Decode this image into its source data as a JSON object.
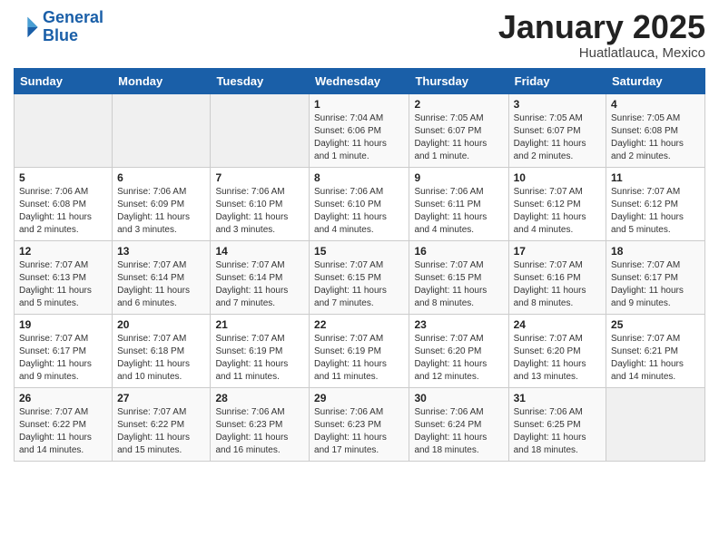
{
  "header": {
    "logo_line1": "General",
    "logo_line2": "Blue",
    "month": "January 2025",
    "location": "Huatlatlauca, Mexico"
  },
  "weekdays": [
    "Sunday",
    "Monday",
    "Tuesday",
    "Wednesday",
    "Thursday",
    "Friday",
    "Saturday"
  ],
  "weeks": [
    [
      {
        "day": "",
        "info": ""
      },
      {
        "day": "",
        "info": ""
      },
      {
        "day": "",
        "info": ""
      },
      {
        "day": "1",
        "info": "Sunrise: 7:04 AM\nSunset: 6:06 PM\nDaylight: 11 hours\nand 1 minute."
      },
      {
        "day": "2",
        "info": "Sunrise: 7:05 AM\nSunset: 6:07 PM\nDaylight: 11 hours\nand 1 minute."
      },
      {
        "day": "3",
        "info": "Sunrise: 7:05 AM\nSunset: 6:07 PM\nDaylight: 11 hours\nand 2 minutes."
      },
      {
        "day": "4",
        "info": "Sunrise: 7:05 AM\nSunset: 6:08 PM\nDaylight: 11 hours\nand 2 minutes."
      }
    ],
    [
      {
        "day": "5",
        "info": "Sunrise: 7:06 AM\nSunset: 6:08 PM\nDaylight: 11 hours\nand 2 minutes."
      },
      {
        "day": "6",
        "info": "Sunrise: 7:06 AM\nSunset: 6:09 PM\nDaylight: 11 hours\nand 3 minutes."
      },
      {
        "day": "7",
        "info": "Sunrise: 7:06 AM\nSunset: 6:10 PM\nDaylight: 11 hours\nand 3 minutes."
      },
      {
        "day": "8",
        "info": "Sunrise: 7:06 AM\nSunset: 6:10 PM\nDaylight: 11 hours\nand 4 minutes."
      },
      {
        "day": "9",
        "info": "Sunrise: 7:06 AM\nSunset: 6:11 PM\nDaylight: 11 hours\nand 4 minutes."
      },
      {
        "day": "10",
        "info": "Sunrise: 7:07 AM\nSunset: 6:12 PM\nDaylight: 11 hours\nand 4 minutes."
      },
      {
        "day": "11",
        "info": "Sunrise: 7:07 AM\nSunset: 6:12 PM\nDaylight: 11 hours\nand 5 minutes."
      }
    ],
    [
      {
        "day": "12",
        "info": "Sunrise: 7:07 AM\nSunset: 6:13 PM\nDaylight: 11 hours\nand 5 minutes."
      },
      {
        "day": "13",
        "info": "Sunrise: 7:07 AM\nSunset: 6:14 PM\nDaylight: 11 hours\nand 6 minutes."
      },
      {
        "day": "14",
        "info": "Sunrise: 7:07 AM\nSunset: 6:14 PM\nDaylight: 11 hours\nand 7 minutes."
      },
      {
        "day": "15",
        "info": "Sunrise: 7:07 AM\nSunset: 6:15 PM\nDaylight: 11 hours\nand 7 minutes."
      },
      {
        "day": "16",
        "info": "Sunrise: 7:07 AM\nSunset: 6:15 PM\nDaylight: 11 hours\nand 8 minutes."
      },
      {
        "day": "17",
        "info": "Sunrise: 7:07 AM\nSunset: 6:16 PM\nDaylight: 11 hours\nand 8 minutes."
      },
      {
        "day": "18",
        "info": "Sunrise: 7:07 AM\nSunset: 6:17 PM\nDaylight: 11 hours\nand 9 minutes."
      }
    ],
    [
      {
        "day": "19",
        "info": "Sunrise: 7:07 AM\nSunset: 6:17 PM\nDaylight: 11 hours\nand 9 minutes."
      },
      {
        "day": "20",
        "info": "Sunrise: 7:07 AM\nSunset: 6:18 PM\nDaylight: 11 hours\nand 10 minutes."
      },
      {
        "day": "21",
        "info": "Sunrise: 7:07 AM\nSunset: 6:19 PM\nDaylight: 11 hours\nand 11 minutes."
      },
      {
        "day": "22",
        "info": "Sunrise: 7:07 AM\nSunset: 6:19 PM\nDaylight: 11 hours\nand 11 minutes."
      },
      {
        "day": "23",
        "info": "Sunrise: 7:07 AM\nSunset: 6:20 PM\nDaylight: 11 hours\nand 12 minutes."
      },
      {
        "day": "24",
        "info": "Sunrise: 7:07 AM\nSunset: 6:20 PM\nDaylight: 11 hours\nand 13 minutes."
      },
      {
        "day": "25",
        "info": "Sunrise: 7:07 AM\nSunset: 6:21 PM\nDaylight: 11 hours\nand 14 minutes."
      }
    ],
    [
      {
        "day": "26",
        "info": "Sunrise: 7:07 AM\nSunset: 6:22 PM\nDaylight: 11 hours\nand 14 minutes."
      },
      {
        "day": "27",
        "info": "Sunrise: 7:07 AM\nSunset: 6:22 PM\nDaylight: 11 hours\nand 15 minutes."
      },
      {
        "day": "28",
        "info": "Sunrise: 7:06 AM\nSunset: 6:23 PM\nDaylight: 11 hours\nand 16 minutes."
      },
      {
        "day": "29",
        "info": "Sunrise: 7:06 AM\nSunset: 6:23 PM\nDaylight: 11 hours\nand 17 minutes."
      },
      {
        "day": "30",
        "info": "Sunrise: 7:06 AM\nSunset: 6:24 PM\nDaylight: 11 hours\nand 18 minutes."
      },
      {
        "day": "31",
        "info": "Sunrise: 7:06 AM\nSunset: 6:25 PM\nDaylight: 11 hours\nand 18 minutes."
      },
      {
        "day": "",
        "info": ""
      }
    ]
  ]
}
